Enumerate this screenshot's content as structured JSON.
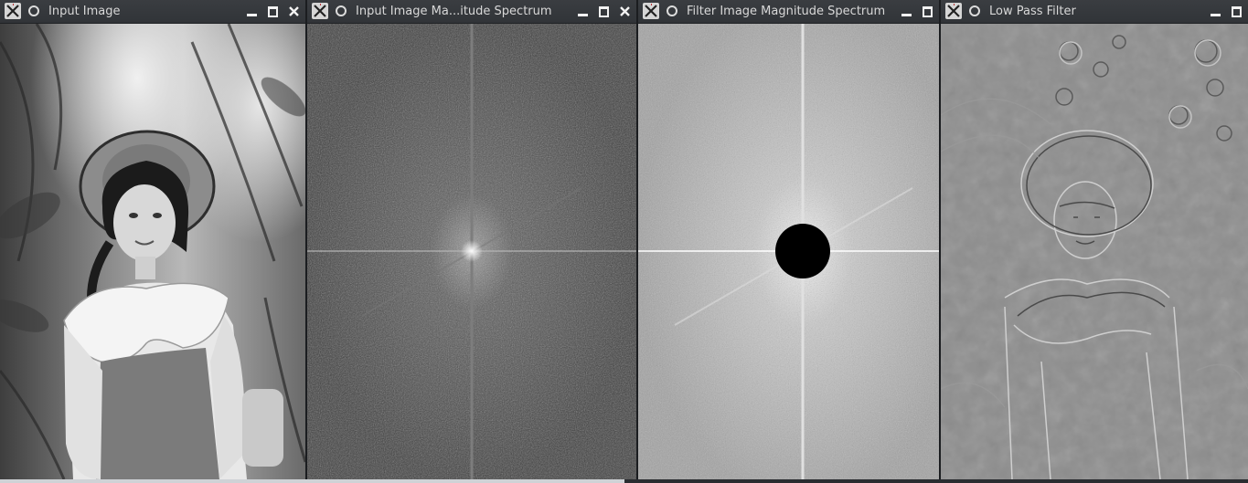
{
  "windows": [
    {
      "id": "input",
      "title": "Input Image",
      "controls": [
        "minimize",
        "maximize",
        "close"
      ]
    },
    {
      "id": "input-spectrum",
      "title": "Input Image Ma...itude Spectrum",
      "controls": [
        "minimize",
        "maximize",
        "close"
      ]
    },
    {
      "id": "filter-spectrum",
      "title": "Filter Image Magnitude Spectrum",
      "controls": [
        "minimize",
        "maximize"
      ]
    },
    {
      "id": "low-pass",
      "title": "Low Pass Filter",
      "controls": [
        "minimize",
        "maximize"
      ]
    }
  ],
  "icons": {
    "app": "x11-app-icon",
    "pin": "pin-icon",
    "minimize": "minimize-icon",
    "maximize": "maximize-icon",
    "close": "close-icon"
  },
  "colors": {
    "titlebar": "#34373b",
    "title_text": "#d8d8d8",
    "control_glyph": "#f2f2f2",
    "filter_mask": "#000000"
  }
}
